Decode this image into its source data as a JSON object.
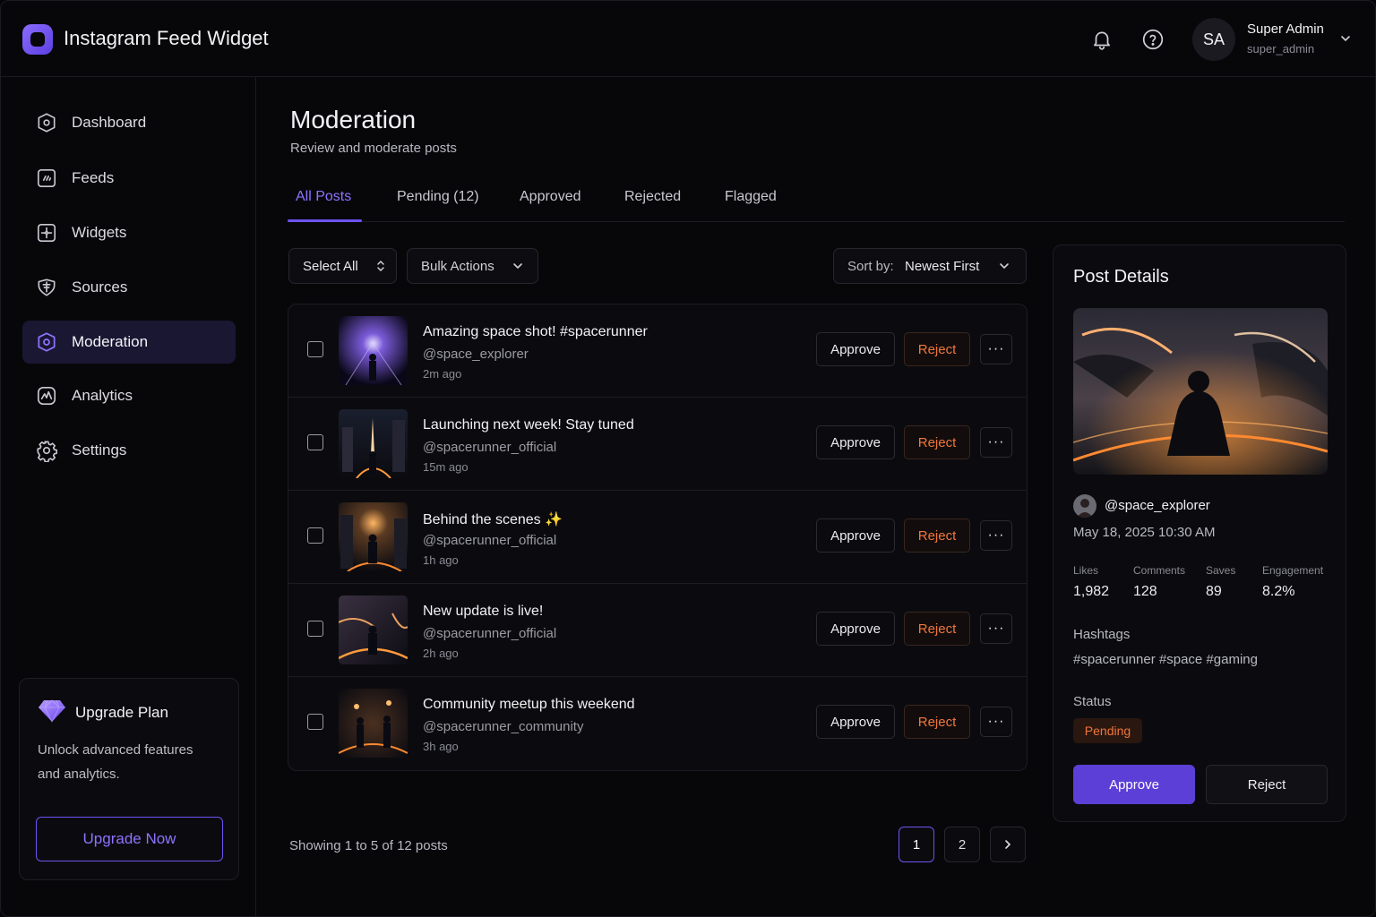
{
  "app": {
    "title": "Instagram Feed Widget"
  },
  "header": {
    "user_initials": "SA",
    "user_name": "Super Admin",
    "user_handle": "super_admin"
  },
  "sidebar": {
    "items": [
      {
        "label": "Dashboard",
        "icon": "dashboard-icon"
      },
      {
        "label": "Feeds",
        "icon": "feeds-icon"
      },
      {
        "label": "Widgets",
        "icon": "widgets-icon"
      },
      {
        "label": "Sources",
        "icon": "sources-icon"
      },
      {
        "label": "Moderation",
        "icon": "moderation-icon",
        "active": true
      },
      {
        "label": "Analytics",
        "icon": "analytics-icon"
      },
      {
        "label": "Settings",
        "icon": "gear-icon"
      }
    ],
    "upgrade": {
      "title": "Upgrade Plan",
      "description": "Unlock advanced features and analytics.",
      "button": "Upgrade Now"
    }
  },
  "main": {
    "title": "Moderation",
    "subtitle": "Review and moderate posts",
    "tabs": [
      {
        "label": "All Posts",
        "active": true
      },
      {
        "label": "Pending (12)"
      },
      {
        "label": "Approved"
      },
      {
        "label": "Rejected"
      },
      {
        "label": "Flagged"
      }
    ],
    "toolbar": {
      "select_all": "Select All",
      "bulk_actions": "Bulk Actions",
      "sort_label": "Sort by:",
      "sort_value": "Newest First"
    },
    "actions": {
      "approve": "Approve",
      "reject": "Reject",
      "more": "···"
    },
    "posts": [
      {
        "title": "Amazing space shot! #spacerunner",
        "user": "@space_explorer",
        "time": "2m ago"
      },
      {
        "title": "Launching next week! Stay tuned",
        "user": "@spacerunner_official",
        "time": "15m ago"
      },
      {
        "title": "Behind the scenes ✨",
        "user": "@spacerunner_official",
        "time": "1h ago"
      },
      {
        "title": "New update is live!",
        "user": "@spacerunner_official",
        "time": "2h ago"
      },
      {
        "title": "Community meetup this weekend",
        "user": "@spacerunner_community",
        "time": "3h ago"
      }
    ],
    "pagination": {
      "showing": "Showing 1 to 5 of 12 posts",
      "pages": [
        "1",
        "2"
      ],
      "current": "1"
    }
  },
  "details": {
    "title": "Post Details",
    "user": "@space_explorer",
    "date": "May 18, 2025 10:30 AM",
    "stats": [
      {
        "label": "Likes",
        "value": "1,982"
      },
      {
        "label": "Comments",
        "value": "128"
      },
      {
        "label": "Saves",
        "value": "89"
      },
      {
        "label": "Engagement",
        "value": "8.2%"
      }
    ],
    "hashtags_label": "Hashtags",
    "hashtags": "#spacerunner #space #gaming",
    "status_label": "Status",
    "status": "Pending",
    "approve": "Approve",
    "reject": "Reject"
  },
  "colors": {
    "accent": "#6d52f0",
    "reject": "#f0763c",
    "background": "#07070a"
  }
}
